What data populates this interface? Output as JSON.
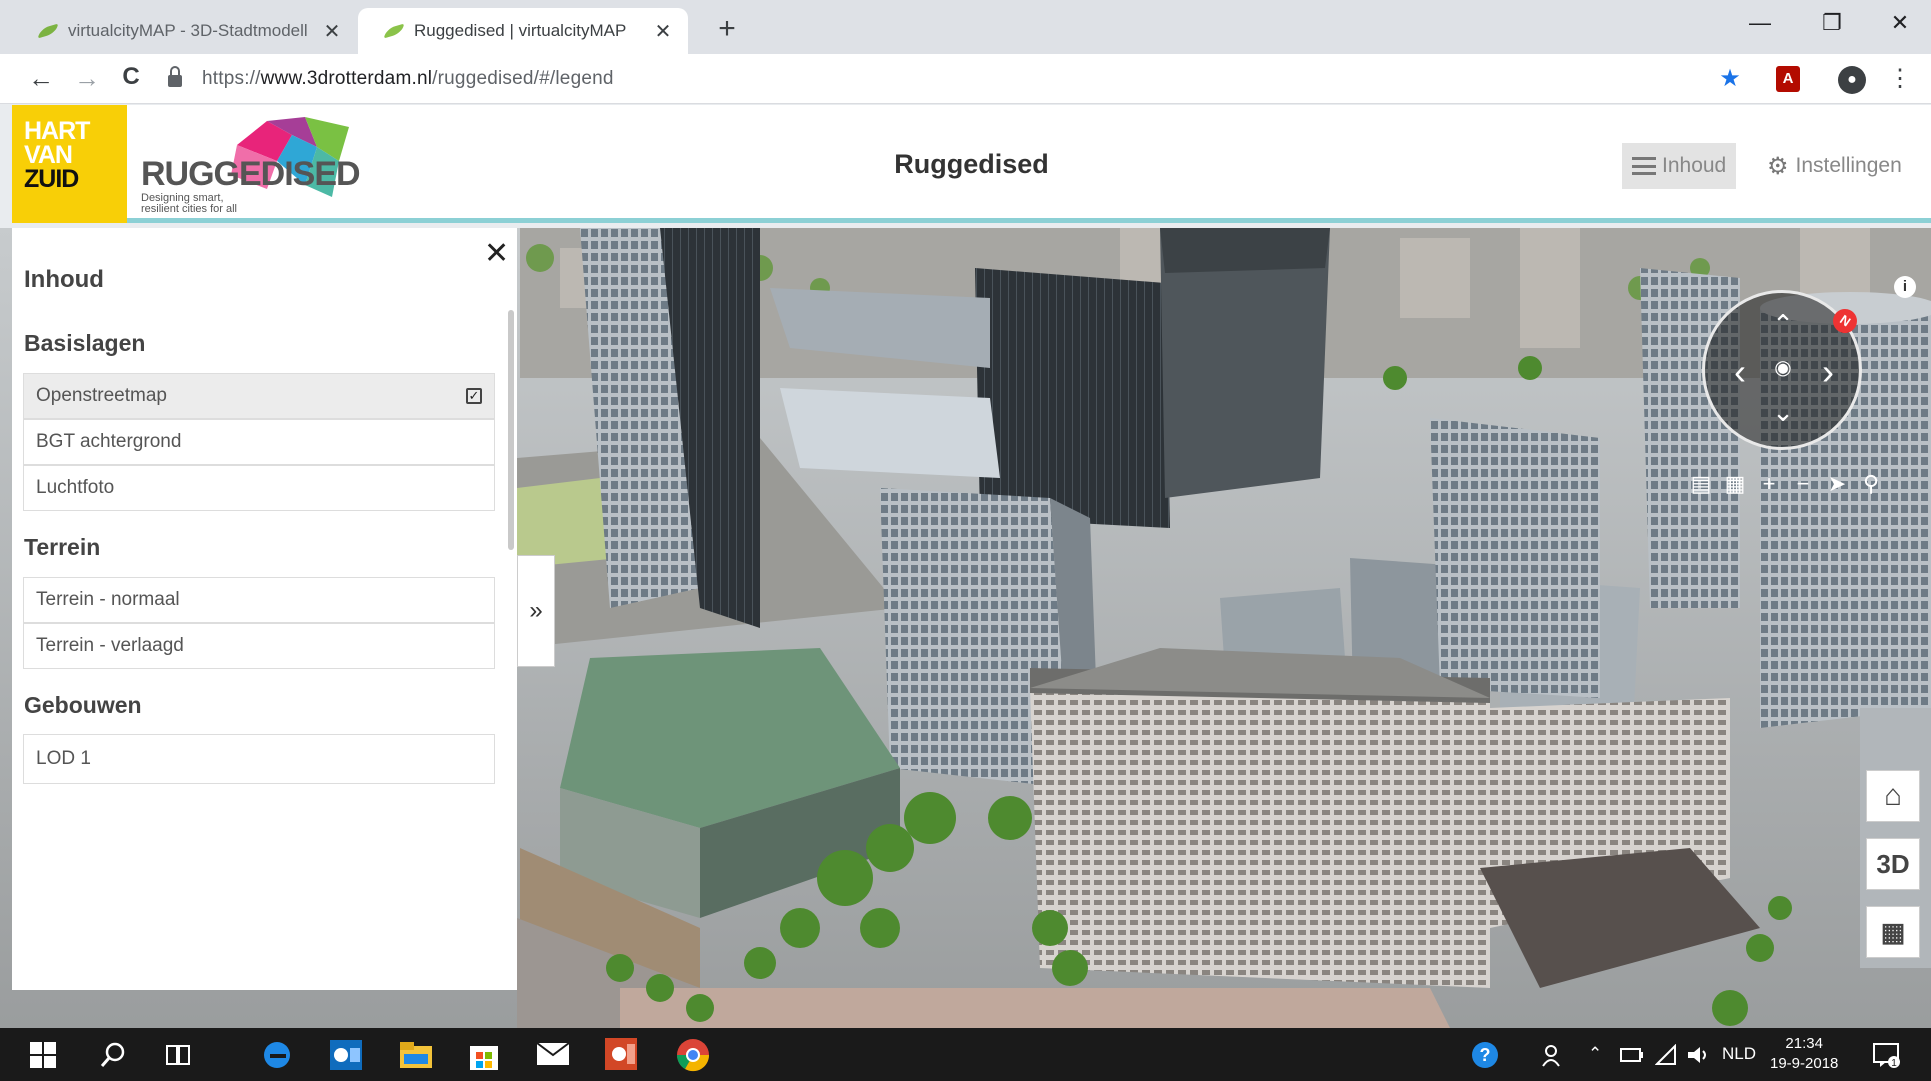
{
  "browser": {
    "tabs": [
      {
        "title": "virtualcityMAP - 3D-Stadtmodell",
        "close": "✕",
        "active": false
      },
      {
        "title": "Ruggedised | virtualcityMAP",
        "close": "✕",
        "active": true
      }
    ],
    "new_tab": "+",
    "window_controls": {
      "minimize": "—",
      "restore": "❐",
      "close": "✕"
    },
    "nav": {
      "back": "←",
      "forward": "→",
      "reload": "C"
    },
    "url_prefix": "https://",
    "url_host": "www.3drotterdam.nl",
    "url_path": "/ruggedised/#/legend",
    "bookmark_star": "★",
    "pdf_ext": "A",
    "account": "●",
    "menu": "⋮"
  },
  "app": {
    "logo_hvz": {
      "l1": "HART",
      "l2": "VAN",
      "l3": "ZUID"
    },
    "logo_ruggedised": {
      "word": "RUGGEDISED",
      "tagline_1": "Designing smart,",
      "tagline_2": "resilient cities for all"
    },
    "title": "Ruggedised",
    "inhoud_button": "Inhoud",
    "settings_button": "Instellingen",
    "gear_icon": "⚙"
  },
  "sidebar": {
    "close": "✕",
    "heading": "Inhoud",
    "sections": [
      {
        "title": "Basislagen",
        "items": [
          {
            "label": "Openstreetmap",
            "checked": true
          },
          {
            "label": "BGT achtergrond",
            "checked": false
          },
          {
            "label": "Luchtfoto",
            "checked": false
          }
        ]
      },
      {
        "title": "Terrein",
        "items": [
          {
            "label": "Terrein - normaal",
            "checked": false
          },
          {
            "label": "Terrein - verlaagd",
            "checked": false
          }
        ]
      },
      {
        "title": "Gebouwen",
        "items": [
          {
            "label": "LOD 1",
            "checked": false
          }
        ]
      }
    ],
    "check_mark": "✓",
    "toggle": "»"
  },
  "map_controls": {
    "compass_north": "N",
    "up": "⌃",
    "down": "⌄",
    "left": "‹",
    "right": "›",
    "eye": "◉",
    "toolbar": [
      "▤",
      "▦",
      "+",
      "−",
      "➤",
      "⚲"
    ],
    "info": "i",
    "home": "⌂",
    "three_d": "3D",
    "grid": "▦"
  },
  "taskbar": {
    "language": "NLD",
    "time": "21:34",
    "date": "19-9-2018"
  },
  "colors": {
    "accent_teal": "#8cd0d5",
    "hvz_yellow": "#f8cf07",
    "taskbar": "#1a1a1a"
  }
}
